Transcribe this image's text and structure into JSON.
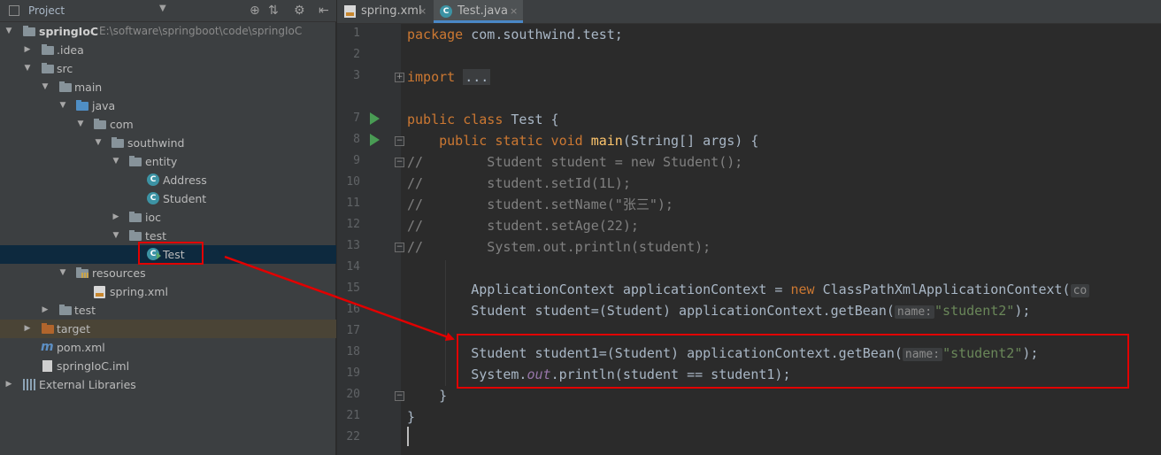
{
  "project_panel": {
    "header": {
      "label": "Project",
      "dropdown_icon": "chevron-down-icon",
      "tools": [
        "scroll-from-source-icon",
        "collapse-all-icon",
        "settings-icon",
        "hide-icon"
      ]
    },
    "tree": {
      "root_name": "springIoC",
      "root_path": "E:\\software\\springboot\\code\\springIoC",
      "idea": ".idea",
      "src": "src",
      "main": "main",
      "java": "java",
      "com": "com",
      "southwind": "southwind",
      "entity": "entity",
      "address": "Address",
      "student": "Student",
      "ioc": "ioc",
      "test_pkg": "test",
      "test_class": "Test",
      "resources": "resources",
      "spring_xml": "spring.xml",
      "test_dir": "test",
      "target": "target",
      "pom": "pom.xml",
      "iml": "springIoC.iml",
      "ext_libs": "External Libraries"
    },
    "class_letter": "C"
  },
  "editor": {
    "tabs": [
      {
        "label": "spring.xml",
        "close": "×"
      },
      {
        "label": "Test.java",
        "close": "×"
      }
    ],
    "line_numbers": [
      "1",
      "2",
      "3",
      "7",
      "8",
      "9",
      "10",
      "11",
      "12",
      "13",
      "14",
      "15",
      "16",
      "17",
      "18",
      "19",
      "20",
      "21",
      "22"
    ],
    "code": {
      "l1_kw": "package",
      "l1_rest": " com.southwind.test;",
      "l3_kw": "import",
      "l3_ellipsis": "...",
      "l7_kw": "public class",
      "l7_rest": " Test {",
      "l8_indent": "    ",
      "l8_kw": "public static void",
      "l8_space": " ",
      "l8_fn": "main",
      "l8_rest": "(String[] args) {",
      "l9": "//        Student student = new Student();",
      "l10": "//        student.setId(1L);",
      "l11": "//        student.setName(\"张三\");",
      "l12": "//        student.setAge(22);",
      "l13": "//        System.out.println(student);",
      "l15_pre": "        ApplicationContext applicationContext = ",
      "l15_kw": "new",
      "l15_post": " ClassPathXmlApplicationContext(",
      "l15_hint": "co",
      "l16_pre": "        Student student=(Student) applicationContext.getBean(",
      "l16_hint": "name:",
      "l16_str": "\"student2\"",
      "l16_post": ");",
      "l18_pre": "        Student student1=(Student) applicationContext.getBean(",
      "l18_hint": "name:",
      "l18_str": "\"student2\"",
      "l18_post": ");",
      "l19_pre": "        System.",
      "l19_fld": "out",
      "l19_post": ".println(student == student1);",
      "l20": "    }",
      "l21": "}"
    }
  },
  "colors": {
    "highlight_box": "#e10000",
    "arrow": "#e10000"
  }
}
